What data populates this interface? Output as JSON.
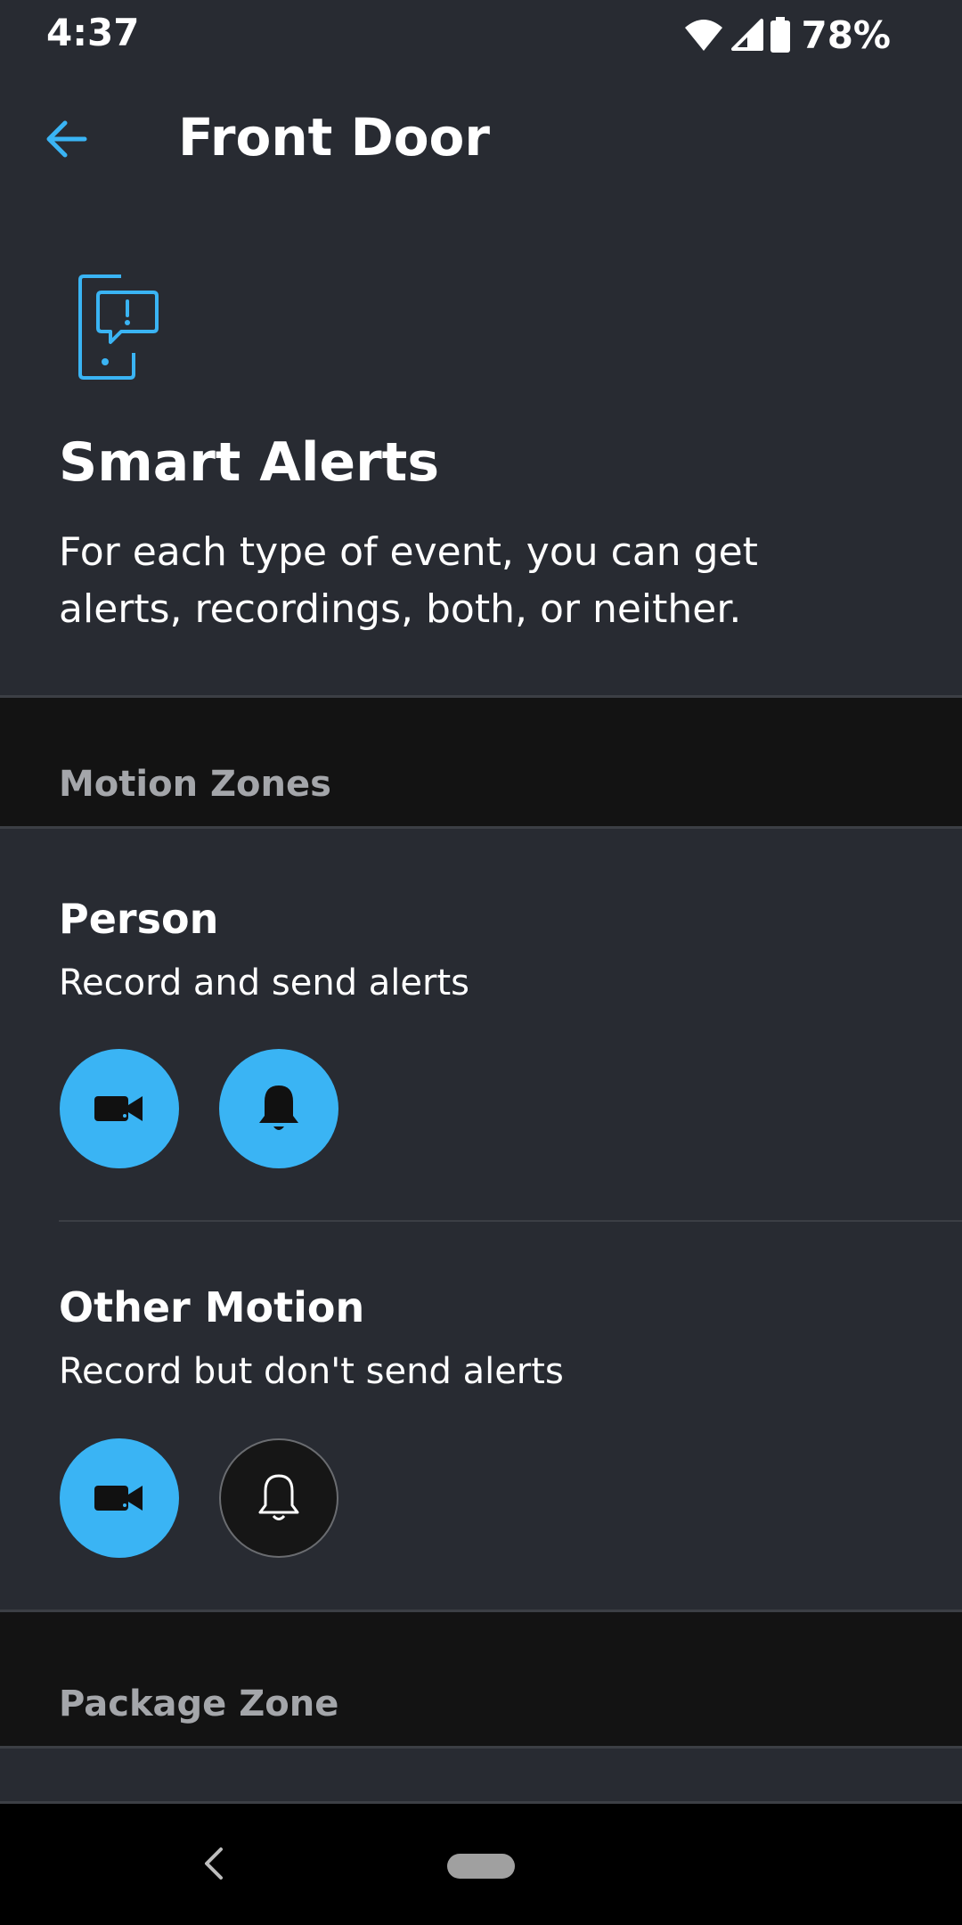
{
  "status_bar": {
    "time": "4:37",
    "battery": "78%"
  },
  "app_bar": {
    "title": "Front Door"
  },
  "intro": {
    "title": "Smart Alerts",
    "description": "For each type of event, you can get alerts, recordings, both, or neither."
  },
  "sections": {
    "motion_zones": "Motion Zones",
    "package_zone": "Package Zone"
  },
  "events": [
    {
      "title": "Person",
      "description": "Record and send alerts",
      "record": true,
      "alerts": true
    },
    {
      "title": "Other Motion",
      "description": "Record but don't send alerts",
      "record": true,
      "alerts": false
    }
  ],
  "colors": {
    "accent": "#3ab4f4",
    "background": "#282b32",
    "section_bg": "#131313"
  },
  "icons": {
    "back": "arrow-left-icon",
    "intro": "phone-alert-icon",
    "record": "video-camera-icon",
    "alerts": "bell-icon"
  }
}
